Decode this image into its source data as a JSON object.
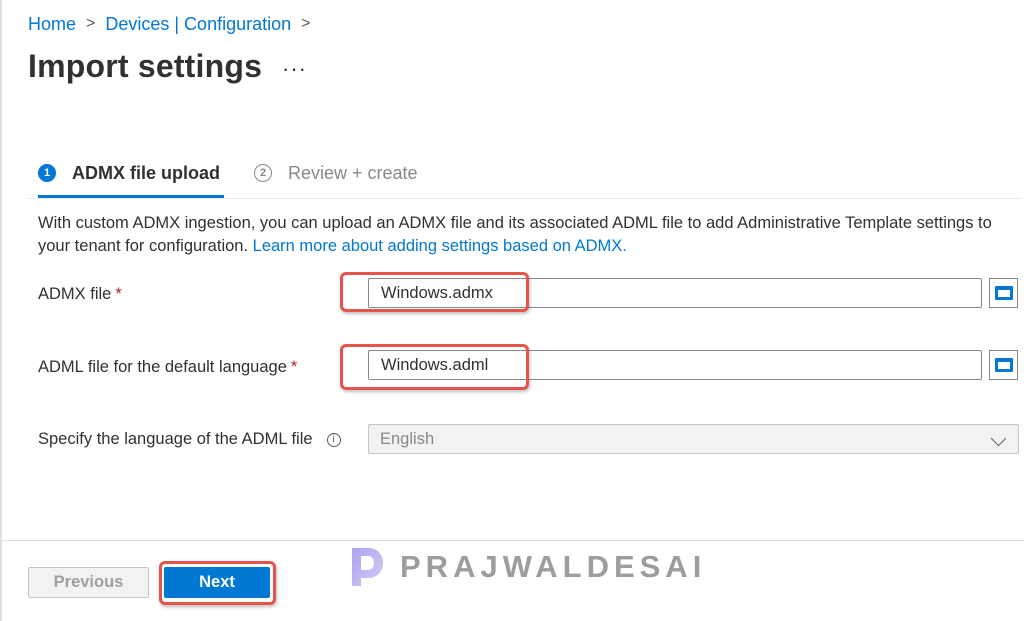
{
  "breadcrumb": {
    "home": "Home",
    "devices": "Devices | Configuration"
  },
  "page": {
    "title": "Import settings",
    "more": "···"
  },
  "steps": [
    {
      "number": "1",
      "label": "ADMX file upload",
      "active": true
    },
    {
      "number": "2",
      "label": "Review + create",
      "active": false
    }
  ],
  "description": {
    "text": "With custom ADMX ingestion, you can upload an ADMX file and its associated ADML file to add Administrative Template settings to your tenant for configuration. ",
    "link": "Learn more about adding settings based on ADMX."
  },
  "fields": {
    "admx": {
      "label": "ADMX file",
      "required": "*",
      "value": "Windows.admx",
      "icon": "folder-icon"
    },
    "adml": {
      "label": "ADML file for the default language",
      "required": "*",
      "value": "Windows.adml",
      "icon": "folder-icon"
    },
    "language": {
      "label": "Specify the language of the ADML file",
      "info": "i",
      "value": "English"
    }
  },
  "footer": {
    "previous": "Previous",
    "next": "Next"
  },
  "watermark": {
    "text": "PRAJWALDESAI"
  },
  "colors": {
    "accent": "#0078d4",
    "highlight": "#e5534b",
    "required": "#a4262c"
  }
}
